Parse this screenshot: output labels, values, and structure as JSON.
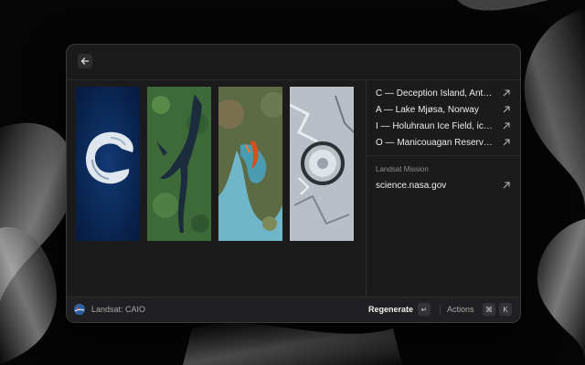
{
  "window": {
    "back_icon": "arrow-left-icon"
  },
  "images": [
    {
      "letter": "C",
      "subject": "Deception Island"
    },
    {
      "letter": "A",
      "subject": "Lake Mjøsa"
    },
    {
      "letter": "I",
      "subject": "Holuhraun Ice Field"
    },
    {
      "letter": "O",
      "subject": "Manicouagan Reservoir"
    }
  ],
  "links": [
    {
      "label": "C — Deception Island, Antarctica",
      "icon": "external-link-icon"
    },
    {
      "label": "A — Lake Mjøsa, Norway",
      "icon": "external-link-icon"
    },
    {
      "label": "I — Holuhraun Ice Field, iceland",
      "icon": "external-link-icon"
    },
    {
      "label": "O — Manicouagan Reservoir, Canada",
      "icon": "external-link-icon"
    }
  ],
  "mission": {
    "section_title": "Landsat Mission",
    "link_label": "science.nasa.gov",
    "icon": "external-link-icon"
  },
  "footer": {
    "title": "Landsat: CAIO",
    "regenerate_label": "Regenerate",
    "enter_key": "↵",
    "actions_label": "Actions",
    "cmd_key": "⌘",
    "k_key": "K"
  },
  "colors": {
    "window_bg": "#1b1b1c",
    "footer_bg": "#202022",
    "text": "#ededed",
    "muted": "#8c8c8e"
  }
}
